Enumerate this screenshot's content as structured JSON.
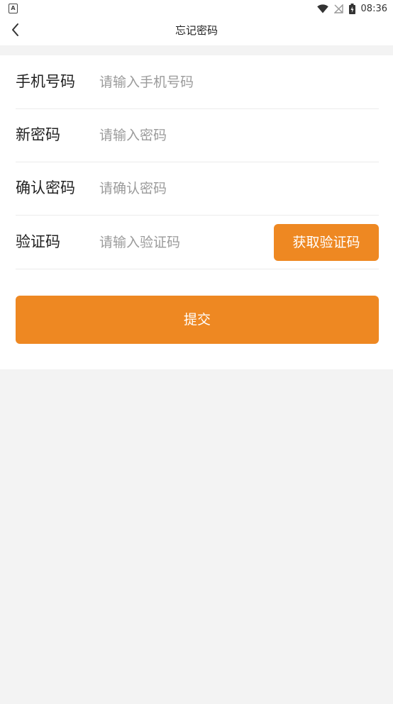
{
  "status_bar": {
    "left_icon": "A",
    "time": "08:36",
    "icons": [
      "wifi-icon",
      "no-signal-icon",
      "battery-icon"
    ]
  },
  "nav": {
    "back_icon": "chevron-left-icon",
    "title": "忘记密码"
  },
  "form": {
    "phone": {
      "label": "手机号码",
      "placeholder": "请输入手机号码",
      "value": ""
    },
    "new_password": {
      "label": "新密码",
      "placeholder": "请输入密码",
      "value": ""
    },
    "confirm_password": {
      "label": "确认密码",
      "placeholder": "请确认密码",
      "value": ""
    },
    "code": {
      "label": "验证码",
      "placeholder": "请输入验证码",
      "value": "",
      "button_label": "获取验证码"
    },
    "submit_label": "提交"
  },
  "colors": {
    "accent": "#ee8822",
    "page_background": "#f3f3f3",
    "card_background": "#ffffff",
    "placeholder": "#9b9b9b"
  }
}
